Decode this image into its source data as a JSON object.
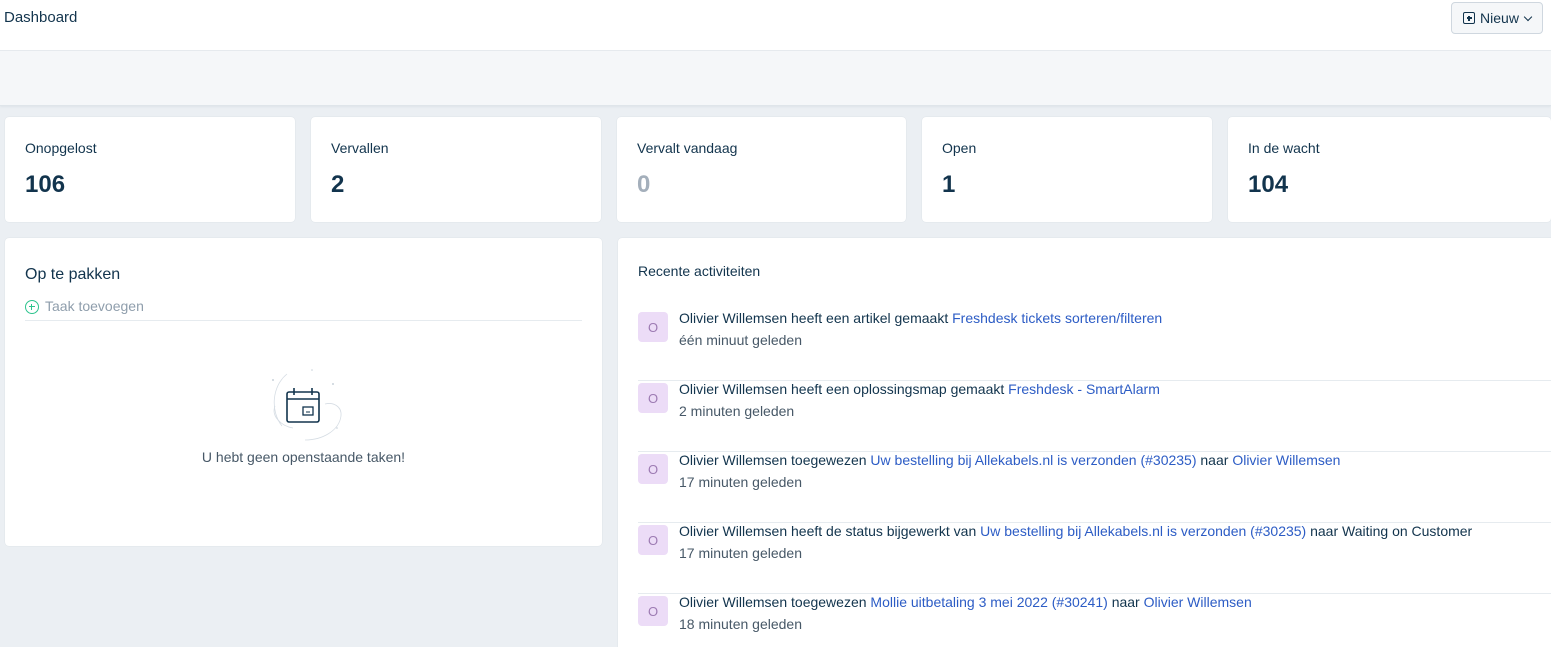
{
  "header": {
    "title": "Dashboard",
    "new_button_label": "Nieuw"
  },
  "stats": [
    {
      "label": "Onopgelost",
      "value": "106"
    },
    {
      "label": "Vervallen",
      "value": "2"
    },
    {
      "label": "Vervalt vandaag",
      "value": "0"
    },
    {
      "label": "Open",
      "value": "1"
    },
    {
      "label": "In de wacht",
      "value": "104"
    }
  ],
  "todo": {
    "title": "Op te pakken",
    "add_task_label": "Taak toevoegen",
    "empty_text": "U hebt geen openstaande taken!"
  },
  "activity": {
    "title": "Recente activiteiten",
    "items": [
      {
        "avatar": "O",
        "actor": "Olivier Willemsen",
        "action": "heeft een artikel gemaakt",
        "link": "Freshdesk tickets sorteren/filteren",
        "suffix": "",
        "target": "",
        "time": "één minuut geleden"
      },
      {
        "avatar": "O",
        "actor": "Olivier Willemsen",
        "action": "heeft een oplossingsmap gemaakt",
        "link": "Freshdesk - SmartAlarm",
        "suffix": "",
        "target": "",
        "time": "2 minuten geleden"
      },
      {
        "avatar": "O",
        "actor": "Olivier Willemsen",
        "action": "toegewezen",
        "link": "Uw bestelling bij Allekabels.nl is verzonden (#30235)",
        "suffix": "naar",
        "target": "Olivier Willemsen",
        "time": "17 minuten geleden"
      },
      {
        "avatar": "O",
        "actor": "Olivier Willemsen",
        "action": "heeft de status bijgewerkt van",
        "link": "Uw bestelling bij Allekabels.nl is verzonden (#30235)",
        "suffix": "naar Waiting on Customer",
        "target": "",
        "time": "17 minuten geleden"
      },
      {
        "avatar": "O",
        "actor": "Olivier Willemsen",
        "action": "toegewezen",
        "link": "Mollie uitbetaling 3 mei 2022 (#30241)",
        "suffix": "naar",
        "target": "Olivier Willemsen",
        "time": "18 minuten geleden"
      }
    ]
  }
}
